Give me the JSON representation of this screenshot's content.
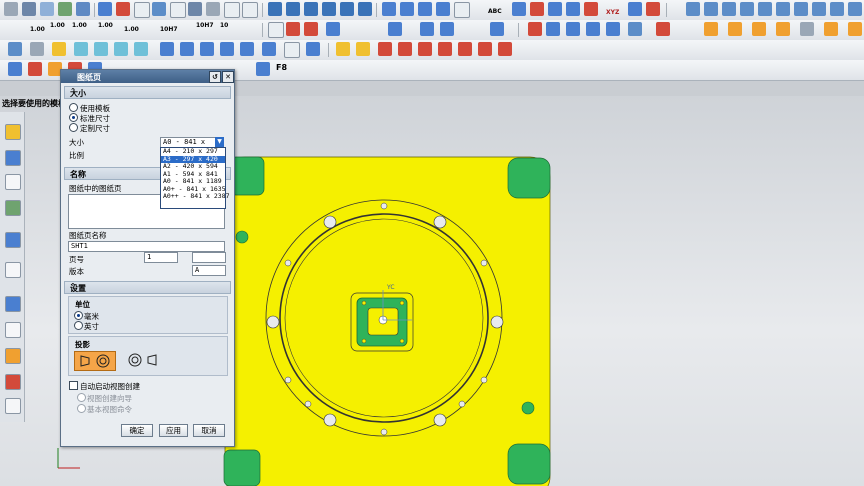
{
  "status": {
    "prompt": "选择要使用的模板"
  },
  "dialog": {
    "title": "图纸页",
    "size_section": {
      "title": "大小",
      "options": [
        "使用模板",
        "标准尺寸",
        "定制尺寸"
      ],
      "selected": "标准尺寸",
      "size_label": "大小",
      "size_value": "A0 - 841 x 1189",
      "scale_label": "比例",
      "size_options": [
        "A4 - 210 x 297",
        "A3 - 297 x 420",
        "A2 - 420 x 594",
        "A1 - 594 x 841",
        "A0 - 841 x 1189",
        "A0+ - 841 x 1635",
        "A0++ - 841 x 2387"
      ],
      "highlighted_option": "A3 - 297 x 420"
    },
    "name_section": {
      "title": "名称",
      "sheets_label": "图纸中的图纸页",
      "sheet_name_label": "图纸页名称",
      "sheet_name_value": "SHT1",
      "page_label": "页号",
      "page_value": "1",
      "revision_label": "版本",
      "revision_value": "A"
    },
    "settings_section": {
      "title": "设置",
      "units_title": "单位",
      "units": [
        "毫米",
        "英寸"
      ],
      "units_selected": "毫米",
      "projection_title": "投影",
      "auto_view_label": "自动启动视图创建",
      "view_options": [
        "视图创建向导",
        "基本视图命令"
      ]
    },
    "buttons": {
      "ok": "确定",
      "apply": "应用",
      "cancel": "取消"
    }
  },
  "model": {
    "label": "YC",
    "body_color": "#f5f000",
    "pocket_color": "#2fb35a"
  },
  "toolbar_text": {
    "r2_1": "1.00",
    "r2_2": "1.00",
    "r2_3": "1.00",
    "r2_4": "1.00",
    "r2_5": "1.00",
    "r2_6": "10H7",
    "r2_7": "10H7",
    "r2_8": "10",
    "abc": "ABC",
    "xyz": "XYZ",
    "f8": "F8"
  },
  "colors": {
    "accent": "#2b6cc8",
    "title_bar": "#4a6d96"
  }
}
